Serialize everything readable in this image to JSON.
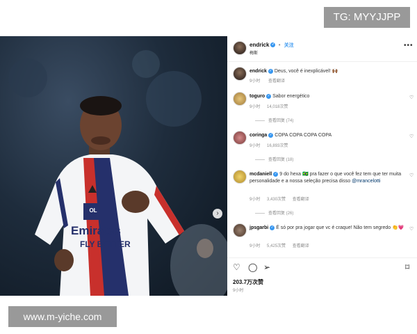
{
  "watermarks": {
    "tg": "TG: MYYJJPP",
    "site": "www.m-yiche.com"
  },
  "photo": {
    "next_icon": "chevron-right-icon",
    "shirt_sponsor_line1": "Emirates",
    "shirt_sponsor_line2": "FLY BETTER",
    "club_badge": "OL"
  },
  "post": {
    "author": "endrick",
    "follow_label": "关注",
    "subtitle": "梅斯",
    "more_icon": "more-horizontal-icon"
  },
  "caption": {
    "user": "endrick",
    "text": "Deus, você é inexplicável! 🙌🏾",
    "time": "9小时",
    "translate": "查看翻译"
  },
  "comments": [
    {
      "user": "toguro",
      "text": "Sabor energético",
      "time": "9小时",
      "likes": "14,018次赞",
      "replies": "查看回复 (74)"
    },
    {
      "user": "coringa",
      "text": "COPA COPA COPA COPA",
      "time": "9小时",
      "likes": "16,893次赞",
      "replies": "查看回复 (18)"
    },
    {
      "user": "mcdaniell",
      "text": "9 do hexa 🇧🇷 pra fazer o que você fez tem que ter muita personalidade e a nossa seleção precisa disso",
      "mention": "@mrancelotti",
      "time": "9小时",
      "likes": "3,430次赞",
      "translate": "查看翻译",
      "replies": "查看回复 (26)"
    },
    {
      "user": "jpsgarbi",
      "text": "É só por pra jogar que vc é craque! Não tem segredo 👏💗",
      "time": "9小时",
      "likes": "5,425次赞",
      "translate": "查看翻译"
    }
  ],
  "footer": {
    "likes": "203.7万次赞",
    "time": "9小时"
  },
  "colors": {
    "accent": "#3897f0",
    "watermark_bg": "#999999"
  }
}
